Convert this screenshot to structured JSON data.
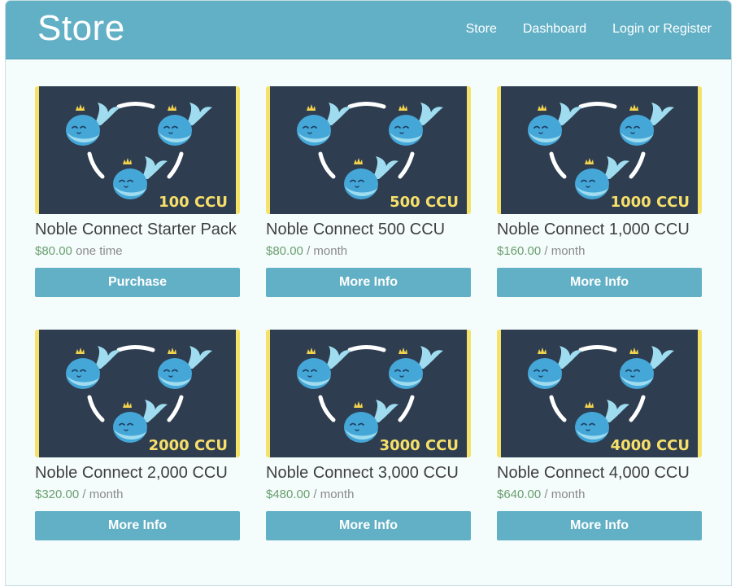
{
  "header": {
    "brand": "Store",
    "nav": [
      "Store",
      "Dashboard",
      "Login or Register"
    ]
  },
  "colors": {
    "accent": "#62b0c6",
    "card_bg": "#2e3d50",
    "label_yellow": "#f7e06a",
    "price_green": "#6aa06f"
  },
  "products": [
    {
      "badge": "100 CCU",
      "title": "Noble Connect Starter Pack",
      "price": "$80.00",
      "period": "one time",
      "button": "Purchase"
    },
    {
      "badge": "500 CCU",
      "title": "Noble Connect 500 CCU",
      "price": "$80.00",
      "period": "/ month",
      "button": "More Info"
    },
    {
      "badge": "1000 CCU",
      "title": "Noble Connect 1,000 CCU",
      "price": "$160.00",
      "period": "/ month",
      "button": "More Info"
    },
    {
      "badge": "2000 CCU",
      "title": "Noble Connect 2,000 CCU",
      "price": "$320.00",
      "period": "/ month",
      "button": "More Info"
    },
    {
      "badge": "3000 CCU",
      "title": "Noble Connect 3,000 CCU",
      "price": "$480.00",
      "period": "/ month",
      "button": "More Info"
    },
    {
      "badge": "4000 CCU",
      "title": "Noble Connect 4,000 CCU",
      "price": "$640.00",
      "period": "/ month",
      "button": "More Info"
    }
  ]
}
